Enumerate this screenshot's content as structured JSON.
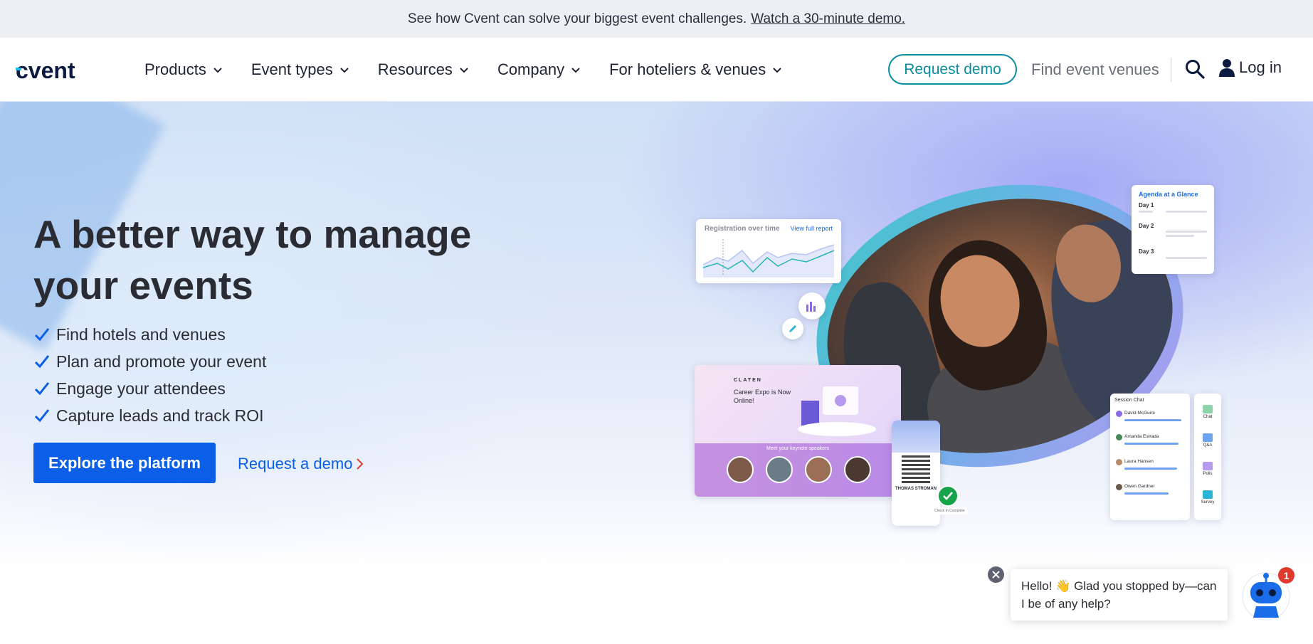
{
  "announcement": {
    "text": "See how Cvent can solve your biggest event challenges.",
    "link": "Watch a 30-minute demo."
  },
  "nav": {
    "logo_text": "cvent",
    "items": [
      {
        "label": "Products"
      },
      {
        "label": "Event types"
      },
      {
        "label": "Resources"
      },
      {
        "label": "Company"
      },
      {
        "label": "For hoteliers & venues"
      }
    ],
    "request_demo": "Request demo",
    "find_venues": "Find event venues",
    "login": "Log in"
  },
  "hero": {
    "headline": "A better way to manage your events",
    "checklist": [
      "Find hotels and venues",
      "Plan and promote your event",
      "Engage your attendees",
      "Capture leads and track ROI"
    ],
    "primary_cta": "Explore the platform",
    "secondary_cta": "Request a demo"
  },
  "collage": {
    "chart_title": "Registration over time",
    "chart_link": "View full report",
    "agenda_title": "Agenda at a Glance",
    "agenda_days": [
      "Day 1",
      "Day 2",
      "Day 3"
    ],
    "site_logo": "CLATEN",
    "site_title": "Career Expo is Now Online!",
    "site_subtitle": "Meet your keynote speakers",
    "badge_name": "THOMAS STROMAN",
    "checkin": "Check In Complete",
    "chat_title": "Session Chat",
    "chat_people": [
      "David McGuire",
      "Amanda Estrada",
      "Laura Hansen",
      "Owen Gardner"
    ],
    "tools": [
      "Chat",
      "Q&A",
      "Polls",
      "Survey"
    ]
  },
  "chat_widget": {
    "message": "Hello! 👋 Glad you stopped by—can I be of any help?",
    "badge_count": "1"
  },
  "colors": {
    "brand_blue": "#0a5ee8",
    "teal": "#0b8ea0",
    "notification_red": "#e03a2f"
  }
}
